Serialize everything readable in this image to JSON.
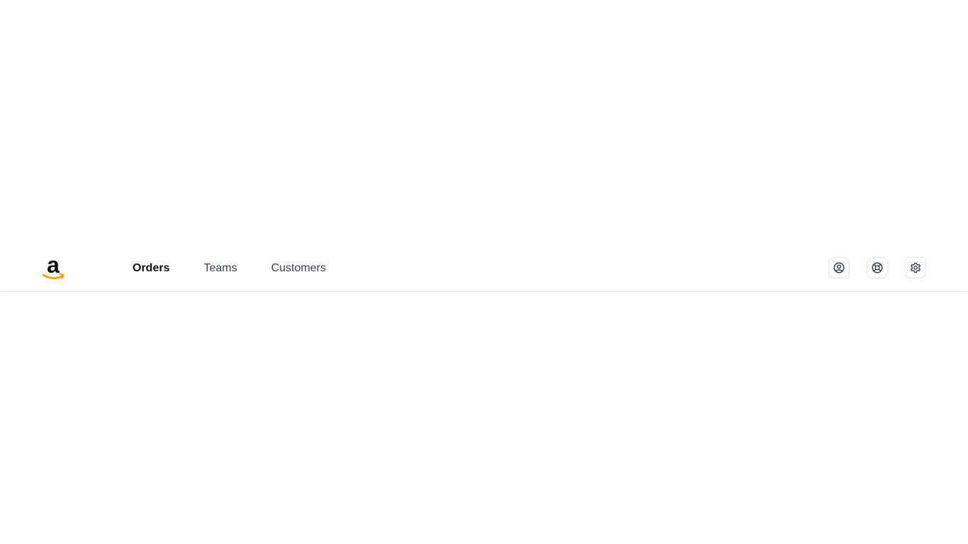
{
  "brand": {
    "logo_icon": "amazon-logo-icon",
    "logo_text": "a",
    "smile_color": "#ff9900"
  },
  "nav": {
    "items": [
      {
        "label": "Orders",
        "active": true
      },
      {
        "label": "Teams",
        "active": false
      },
      {
        "label": "Customers",
        "active": false
      }
    ]
  },
  "actions": [
    {
      "icon": "user-icon"
    },
    {
      "icon": "lifebuoy-icon"
    },
    {
      "icon": "gear-icon"
    }
  ],
  "colors": {
    "active_text": "#111111",
    "inactive_text": "#374151",
    "border": "#e5e7eb",
    "icon": "#374151"
  }
}
